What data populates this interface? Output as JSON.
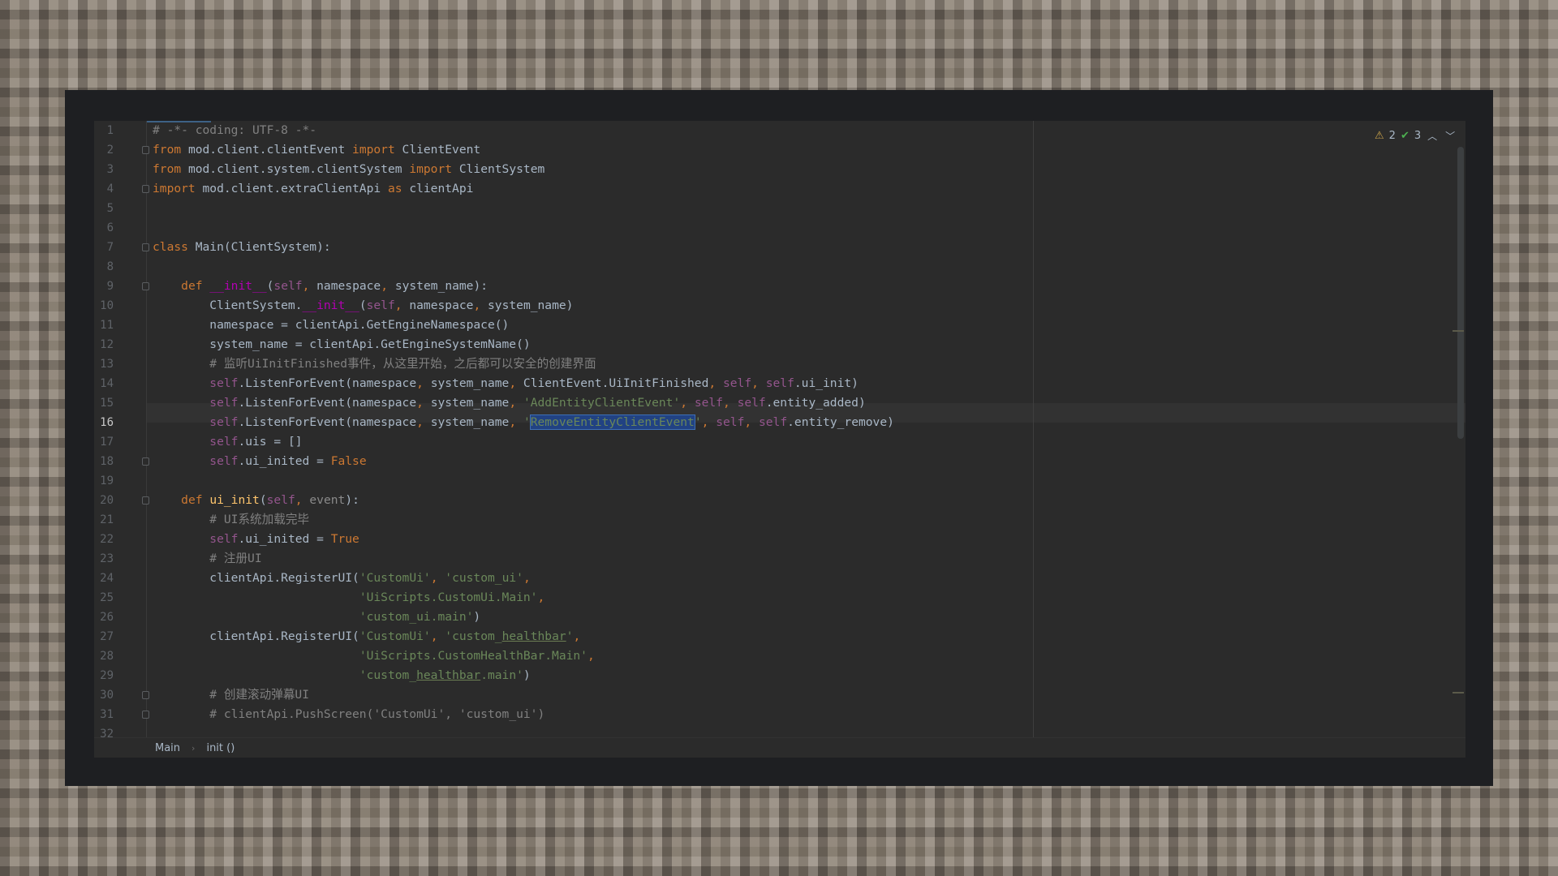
{
  "inspection": {
    "warnings": "2",
    "weak_warnings": "3"
  },
  "breadcrumb": {
    "item1": "Main",
    "item2": "init",
    "item2_suffix": "()"
  },
  "editor": {
    "current_line": 16,
    "line_numbers": [
      "1",
      "2",
      "3",
      "4",
      "5",
      "6",
      "7",
      "8",
      "9",
      "10",
      "11",
      "12",
      "13",
      "14",
      "15",
      "16",
      "17",
      "18",
      "19",
      "20",
      "21",
      "22",
      "23",
      "24",
      "25",
      "26",
      "27",
      "28",
      "29",
      "30",
      "31",
      "32"
    ],
    "lines": [
      [
        [
          "cm",
          "# -*- coding: UTF-8 -*-"
        ]
      ],
      [
        [
          "kw",
          "from"
        ],
        [
          "p",
          " mod.client.clientEvent "
        ],
        [
          "kw",
          "import"
        ],
        [
          "p",
          " ClientEvent"
        ]
      ],
      [
        [
          "kw",
          "from"
        ],
        [
          "p",
          " mod.client.system.clientSystem "
        ],
        [
          "kw",
          "import"
        ],
        [
          "p",
          " ClientSystem"
        ]
      ],
      [
        [
          "kw",
          "import"
        ],
        [
          "p",
          " mod.client.extraClientApi "
        ],
        [
          "kw",
          "as"
        ],
        [
          "p",
          " clientApi"
        ]
      ],
      [],
      [],
      [
        [
          "kw",
          "class"
        ],
        [
          "p",
          " Main(ClientSystem):"
        ]
      ],
      [],
      [
        [
          "p",
          "    "
        ],
        [
          "kw",
          "def"
        ],
        [
          "p",
          " "
        ],
        [
          "magic",
          "__init__"
        ],
        [
          "p",
          "("
        ],
        [
          "self",
          "self"
        ],
        [
          "comma",
          ","
        ],
        [
          "p",
          " namespace"
        ],
        [
          "comma",
          ","
        ],
        [
          "p",
          " system_name):"
        ]
      ],
      [
        [
          "p",
          "        ClientSystem."
        ],
        [
          "magic",
          "__init__"
        ],
        [
          "p",
          "("
        ],
        [
          "self",
          "self"
        ],
        [
          "comma",
          ","
        ],
        [
          "p",
          " namespace"
        ],
        [
          "comma",
          ","
        ],
        [
          "p",
          " system_name)"
        ]
      ],
      [
        [
          "p",
          "        namespace = clientApi.GetEngineNamespace()"
        ]
      ],
      [
        [
          "p",
          "        system_name = clientApi.GetEngineSystemName()"
        ]
      ],
      [
        [
          "p",
          "        "
        ],
        [
          "cm",
          "# 监听UiInitFinished事件，从这里开始，之后都可以安全的创建界面"
        ]
      ],
      [
        [
          "p",
          "        "
        ],
        [
          "self",
          "self"
        ],
        [
          "p",
          ".ListenForEvent(namespace"
        ],
        [
          "comma",
          ","
        ],
        [
          "p",
          " system_name"
        ],
        [
          "comma",
          ","
        ],
        [
          "p",
          " ClientEvent.UiInitFinished"
        ],
        [
          "comma",
          ","
        ],
        [
          "p",
          " "
        ],
        [
          "self",
          "self"
        ],
        [
          "comma",
          ","
        ],
        [
          "p",
          " "
        ],
        [
          "self",
          "self"
        ],
        [
          "p",
          ".ui_init)"
        ]
      ],
      [
        [
          "p",
          "        "
        ],
        [
          "self",
          "self"
        ],
        [
          "p",
          ".ListenForEvent(namespace"
        ],
        [
          "comma",
          ","
        ],
        [
          "p",
          " system_name"
        ],
        [
          "comma",
          ","
        ],
        [
          "p",
          " "
        ],
        [
          "str",
          "'AddEntityClientEvent'"
        ],
        [
          "comma",
          ","
        ],
        [
          "p",
          " "
        ],
        [
          "self",
          "self"
        ],
        [
          "comma",
          ","
        ],
        [
          "p",
          " "
        ],
        [
          "self",
          "self"
        ],
        [
          "p",
          ".entity_added)"
        ]
      ],
      [
        [
          "p",
          "        "
        ],
        [
          "self",
          "self"
        ],
        [
          "p",
          ".ListenForEvent(namespace"
        ],
        [
          "comma",
          ","
        ],
        [
          "p",
          " system_name"
        ],
        [
          "comma",
          ","
        ],
        [
          "p",
          " "
        ],
        [
          "str",
          "'"
        ],
        [
          "sel",
          "RemoveEntityClientEvent"
        ],
        [
          "str",
          "'"
        ],
        [
          "comma",
          ","
        ],
        [
          "p",
          " "
        ],
        [
          "self",
          "self"
        ],
        [
          "comma",
          ","
        ],
        [
          "p",
          " "
        ],
        [
          "self",
          "self"
        ],
        [
          "p",
          ".entity_remove)"
        ]
      ],
      [
        [
          "p",
          "        "
        ],
        [
          "self",
          "self"
        ],
        [
          "p",
          ".uis = []"
        ]
      ],
      [
        [
          "p",
          "        "
        ],
        [
          "self",
          "self"
        ],
        [
          "p",
          ".ui_inited = "
        ],
        [
          "kw",
          "False"
        ]
      ],
      [],
      [
        [
          "p",
          "    "
        ],
        [
          "kw",
          "def"
        ],
        [
          "p",
          " "
        ],
        [
          "fn",
          "ui_init"
        ],
        [
          "p",
          "("
        ],
        [
          "self",
          "self"
        ],
        [
          "comma",
          ","
        ],
        [
          "p",
          " "
        ],
        [
          "param",
          "event"
        ],
        [
          "p",
          "):"
        ]
      ],
      [
        [
          "p",
          "        "
        ],
        [
          "cm",
          "# UI系统加载完毕"
        ]
      ],
      [
        [
          "p",
          "        "
        ],
        [
          "self",
          "self"
        ],
        [
          "p",
          ".ui_inited = "
        ],
        [
          "kw",
          "True"
        ]
      ],
      [
        [
          "p",
          "        "
        ],
        [
          "cm",
          "# 注册UI"
        ]
      ],
      [
        [
          "p",
          "        clientApi.RegisterUI("
        ],
        [
          "str",
          "'CustomUi'"
        ],
        [
          "comma",
          ","
        ],
        [
          "p",
          " "
        ],
        [
          "str",
          "'custom_ui'"
        ],
        [
          "comma",
          ","
        ]
      ],
      [
        [
          "p",
          "                             "
        ],
        [
          "str",
          "'UiScripts.CustomUi.Main'"
        ],
        [
          "comma",
          ","
        ]
      ],
      [
        [
          "p",
          "                             "
        ],
        [
          "str",
          "'custom_ui.main'"
        ],
        [
          "p",
          ")"
        ]
      ],
      [
        [
          "p",
          "        clientApi.RegisterUI("
        ],
        [
          "str",
          "'CustomUi'"
        ],
        [
          "comma",
          ","
        ],
        [
          "p",
          " "
        ],
        [
          "str",
          "'custom_"
        ],
        [
          "typo",
          "healthbar"
        ],
        [
          "str",
          "'"
        ],
        [
          "comma",
          ","
        ]
      ],
      [
        [
          "p",
          "                             "
        ],
        [
          "str",
          "'UiScripts.CustomHealthBar.Main'"
        ],
        [
          "comma",
          ","
        ]
      ],
      [
        [
          "p",
          "                             "
        ],
        [
          "str",
          "'custom_"
        ],
        [
          "typo",
          "healthbar"
        ],
        [
          "str",
          ".main'"
        ],
        [
          "p",
          ")"
        ]
      ],
      [
        [
          "p",
          "        "
        ],
        [
          "cm",
          "# 创建滚动弹幕UI"
        ]
      ],
      [
        [
          "p",
          "        "
        ],
        [
          "cm",
          "# clientApi.PushScreen('CustomUi', 'custom_ui')"
        ]
      ],
      []
    ]
  }
}
